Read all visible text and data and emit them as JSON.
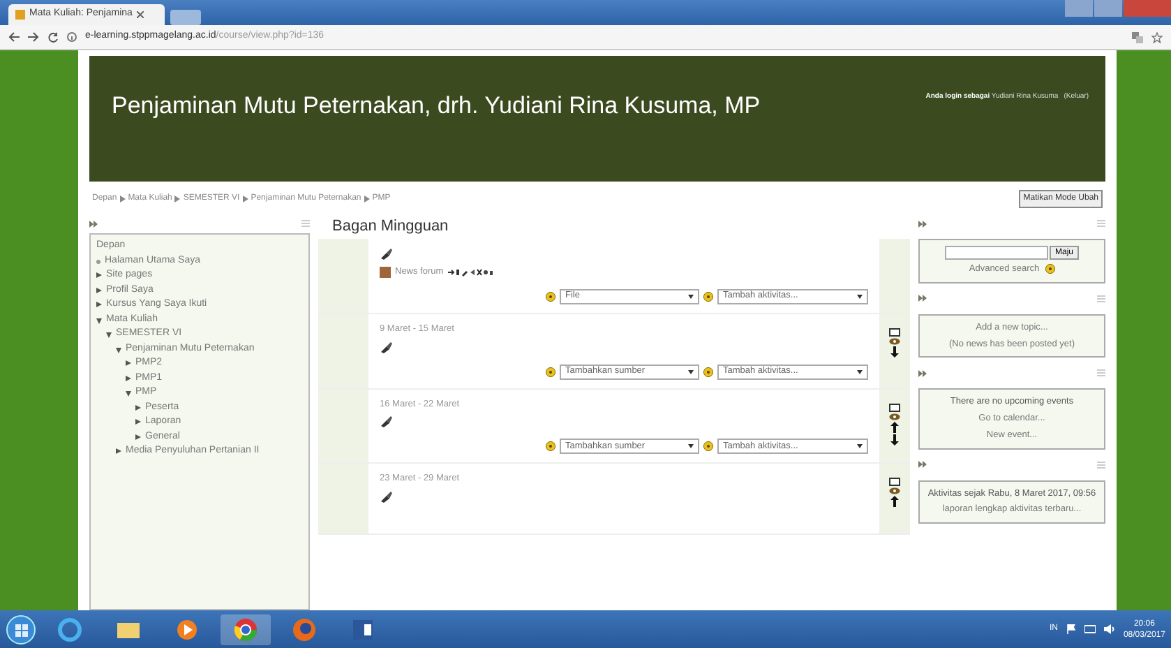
{
  "browser": {
    "tab_title": "Mata Kuliah: Penjamina",
    "url_host": "e-learning.stppmagelang.ac.id",
    "url_path": "/course/view.php?id=136"
  },
  "header": {
    "title": "Penjaminan Mutu Peternakan, drh. Yudiani Rina Kusuma, MP",
    "login_label": "Anda login sebagai",
    "login_name": "Yudiani Rina Kusuma",
    "logout": "(Keluar)"
  },
  "breadcrumb": {
    "items": [
      "Depan",
      "Mata Kuliah",
      "SEMESTER VI",
      "Penjaminan Mutu Peternakan",
      "PMP"
    ],
    "edit_button": "Matikan Mode Ubah"
  },
  "navigation": {
    "items": [
      {
        "label": "Depan",
        "kind": "heading"
      },
      {
        "label": "Halaman Utama Saya",
        "kind": "leaf"
      },
      {
        "label": "Site pages",
        "kind": "branch",
        "expanded": false
      },
      {
        "label": "Profil Saya",
        "kind": "branch",
        "expanded": false
      },
      {
        "label": "Kursus Yang Saya Ikuti",
        "kind": "branch",
        "expanded": false
      },
      {
        "label": "Mata Kuliah",
        "kind": "branch",
        "expanded": true,
        "children": [
          {
            "label": "SEMESTER VI",
            "kind": "branch",
            "expanded": true,
            "children": [
              {
                "label": "Penjaminan Mutu Peternakan",
                "kind": "branch",
                "expanded": true,
                "children": [
                  {
                    "label": "PMP2",
                    "kind": "branch",
                    "expanded": false
                  },
                  {
                    "label": "PMP1",
                    "kind": "branch",
                    "expanded": false
                  },
                  {
                    "label": "PMP",
                    "kind": "branch",
                    "expanded": true,
                    "children": [
                      {
                        "label": "Peserta",
                        "kind": "branch",
                        "expanded": false
                      },
                      {
                        "label": "Laporan",
                        "kind": "branch",
                        "expanded": false
                      },
                      {
                        "label": "General",
                        "kind": "branch",
                        "expanded": false
                      }
                    ]
                  }
                ]
              },
              {
                "label": "Media Penyuluhan Pertanian II",
                "kind": "branch",
                "expanded": false
              }
            ]
          }
        ]
      }
    ]
  },
  "course": {
    "heading": "Bagan Mingguan",
    "sections": [
      {
        "forum": "News forum",
        "selects": [
          "File",
          "Tambah aktivitas..."
        ]
      },
      {
        "date": "9 Maret - 15 Maret",
        "selects": [
          "Tambahkan sumber",
          "Tambah aktivitas..."
        ],
        "move_up": false,
        "move_down": true
      },
      {
        "date": "16 Maret - 22 Maret",
        "selects": [
          "Tambahkan sumber",
          "Tambah aktivitas..."
        ],
        "move_up": true,
        "move_down": true
      },
      {
        "date": "23 Maret - 29 Maret",
        "move_up": true,
        "move_down": false
      }
    ]
  },
  "blocks": [
    {
      "kind": "search",
      "button": "Maju",
      "link": "Advanced search"
    },
    {
      "kind": "news",
      "lines": [
        "Add a new topic...",
        "(No news has been posted yet)"
      ]
    },
    {
      "kind": "events",
      "text": "There are no upcoming events",
      "lines": [
        "Go to calendar...",
        "New event..."
      ]
    },
    {
      "kind": "activity",
      "text": "Aktivitas sejak Rabu, 8 Maret 2017, 09:56",
      "lines": [
        "laporan lengkap aktivitas terbaru..."
      ]
    }
  ],
  "taskbar": {
    "tray_lang": "IN",
    "time": "20:06",
    "date": "08/03/2017"
  }
}
